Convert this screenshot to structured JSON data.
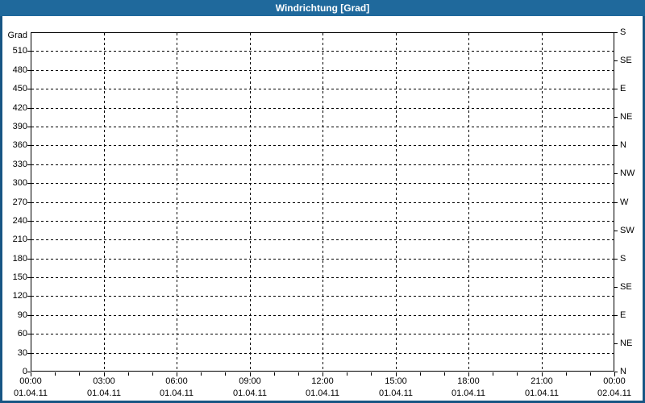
{
  "window": {
    "title": "Windrichtung [Grad]"
  },
  "colors": {
    "titlebar_bg": "#1f699c",
    "titlebar_text": "#ffffff",
    "frame_border": "#185684",
    "background": "#ffffff",
    "axis_line": "#000000",
    "grid_line": "#000000",
    "tick_text": "#000000"
  },
  "chart_data": {
    "type": "line",
    "title": "Windrichtung [Grad]",
    "series": [],
    "grid": true,
    "legend_position": "none",
    "y_axis": {
      "label": "Grad",
      "range": [
        0,
        540
      ],
      "tick_step": 30,
      "ticks": [
        0,
        30,
        60,
        90,
        120,
        150,
        180,
        210,
        240,
        270,
        300,
        330,
        360,
        390,
        420,
        450,
        480,
        510
      ]
    },
    "y_axis_right": {
      "tick_step_deg": 45,
      "labels": [
        {
          "deg": 0,
          "label": "N"
        },
        {
          "deg": 45,
          "label": "NE"
        },
        {
          "deg": 90,
          "label": "E"
        },
        {
          "deg": 135,
          "label": "SE"
        },
        {
          "deg": 180,
          "label": "S"
        },
        {
          "deg": 225,
          "label": "SW"
        },
        {
          "deg": 270,
          "label": "W"
        },
        {
          "deg": 315,
          "label": "NW"
        },
        {
          "deg": 360,
          "label": "N"
        },
        {
          "deg": 405,
          "label": "NE"
        },
        {
          "deg": 450,
          "label": "E"
        },
        {
          "deg": 495,
          "label": "SE"
        },
        {
          "deg": 540,
          "label": "S"
        }
      ]
    },
    "x_axis": {
      "range_hours": [
        0,
        24
      ],
      "minor_tick_hours": 1,
      "major_ticks": [
        {
          "hour": 0,
          "time": "00:00",
          "date": "01.04.11"
        },
        {
          "hour": 3,
          "time": "03:00",
          "date": "01.04.11"
        },
        {
          "hour": 6,
          "time": "06:00",
          "date": "01.04.11"
        },
        {
          "hour": 9,
          "time": "09:00",
          "date": "01.04.11"
        },
        {
          "hour": 12,
          "time": "12:00",
          "date": "01.04.11"
        },
        {
          "hour": 15,
          "time": "15:00",
          "date": "01.04.11"
        },
        {
          "hour": 18,
          "time": "18:00",
          "date": "01.04.11"
        },
        {
          "hour": 21,
          "time": "21:00",
          "date": "01.04.11"
        },
        {
          "hour": 24,
          "time": "00:00",
          "date": "02.04.11"
        }
      ]
    }
  }
}
